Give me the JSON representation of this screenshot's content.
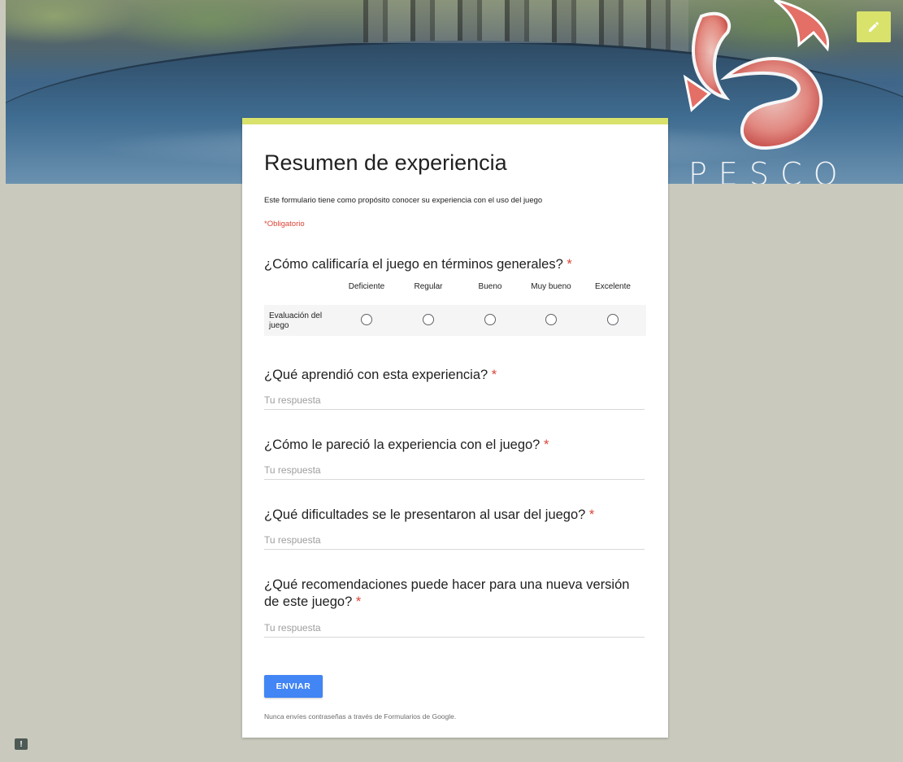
{
  "header": {
    "logo_text": "PESCO",
    "accent_color": "#d9e26b"
  },
  "form": {
    "title": "Resumen de experiencia",
    "description": "Este formulario tiene como propósito conocer su experiencia con el uso del juego",
    "required_note": "*Obligatorio",
    "rating_question": {
      "text": "¿Cómo calificaría el juego en términos generales?",
      "required_mark": "*",
      "columns": [
        "Deficiente",
        "Regular",
        "Bueno",
        "Muy bueno",
        "Excelente"
      ],
      "row_label": "Evaluación del juego"
    },
    "questions": [
      {
        "text": "¿Qué aprendió con esta experiencia?",
        "required_mark": "*",
        "placeholder": "Tu respuesta"
      },
      {
        "text": "¿Cómo le pareció la experiencia con el juego?",
        "required_mark": "*",
        "placeholder": "Tu respuesta"
      },
      {
        "text": "¿Qué dificultades se le presentaron al usar del juego?",
        "required_mark": "*",
        "placeholder": "Tu respuesta"
      },
      {
        "text": "¿Qué recomendaciones puede hacer para una nueva versión de este juego?",
        "required_mark": "*",
        "placeholder": "Tu respuesta"
      }
    ],
    "submit_label": "ENVIAR",
    "footer_note": "Nunca envíes contraseñas a través de Formularios de Google.",
    "submit_color": "#4285f4"
  },
  "feedback": {
    "icon": "feedback-icon",
    "glyph": "!"
  }
}
